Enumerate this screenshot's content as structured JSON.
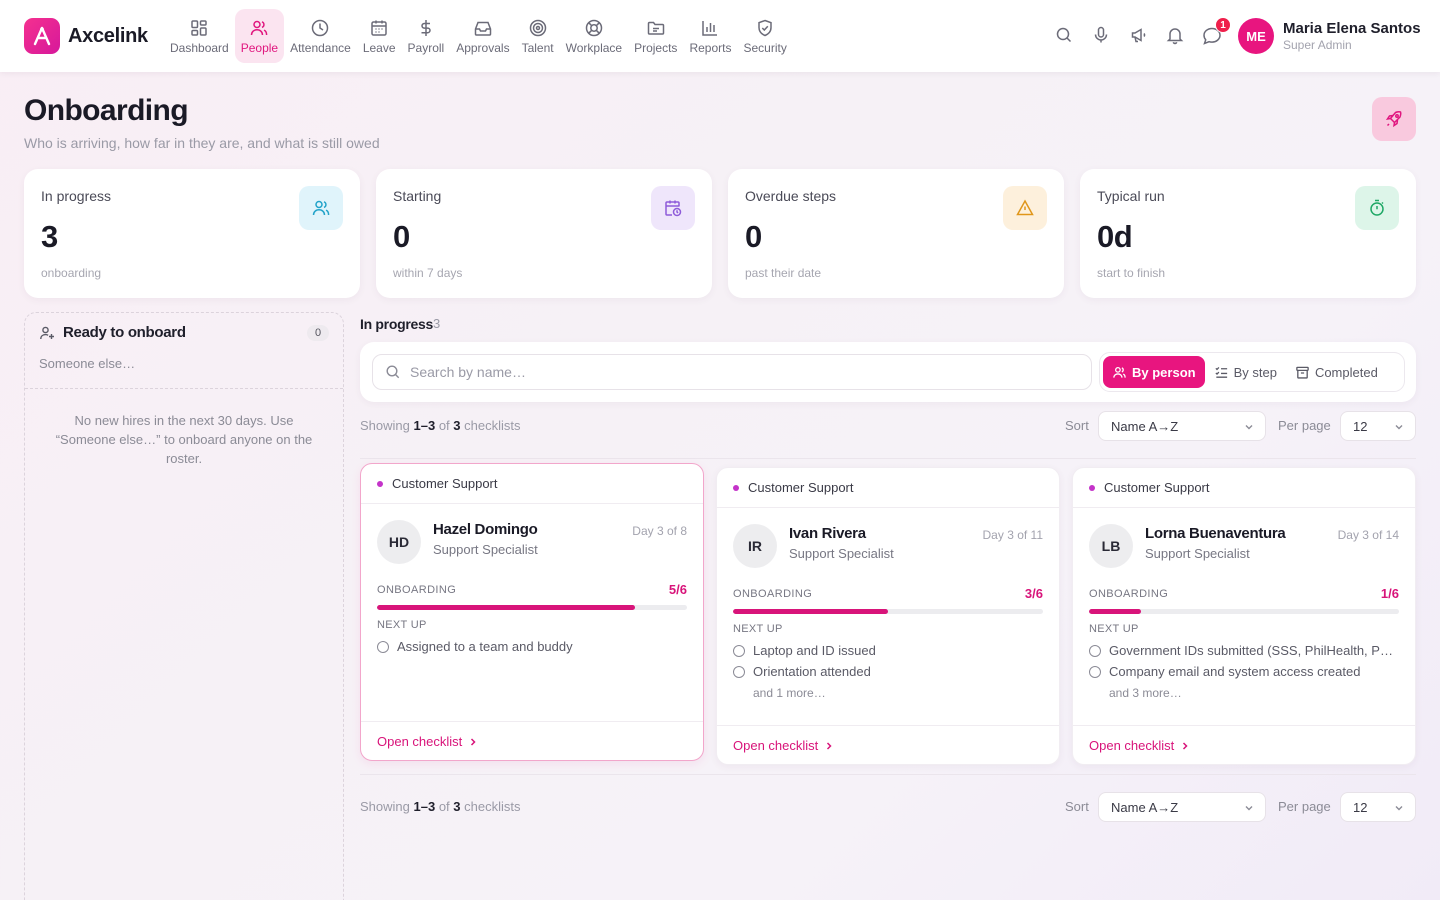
{
  "app": {
    "name": "Axcelink",
    "colors": {
      "accent": "#e8157f",
      "accent_soft": "#fbe4f0",
      "danger": "#ef1f4b"
    }
  },
  "nav": [
    {
      "label": "Dashboard",
      "icon": "dashboard-icon",
      "active": false
    },
    {
      "label": "People",
      "icon": "people-icon",
      "active": true
    },
    {
      "label": "Attendance",
      "icon": "clock-icon",
      "active": false
    },
    {
      "label": "Leave",
      "icon": "calendar-icon",
      "active": false
    },
    {
      "label": "Payroll",
      "icon": "dollar-icon",
      "active": false
    },
    {
      "label": "Approvals",
      "icon": "inbox-icon",
      "active": false
    },
    {
      "label": "Talent",
      "icon": "target-icon",
      "active": false
    },
    {
      "label": "Workplace",
      "icon": "lifebuoy-icon",
      "active": false
    },
    {
      "label": "Projects",
      "icon": "folder-icon",
      "active": false
    },
    {
      "label": "Reports",
      "icon": "bar-chart-icon",
      "active": false
    },
    {
      "label": "Security",
      "icon": "shield-icon",
      "active": false
    }
  ],
  "header": {
    "notification_count": "1",
    "user": {
      "initials": "ME",
      "name": "Maria Elena Santos",
      "role": "Super Admin"
    }
  },
  "page": {
    "title": "Onboarding",
    "subtitle": "Who is arriving, how far in they are, and what is still owed"
  },
  "stats": [
    {
      "label": "In progress",
      "value": "3",
      "note": "onboarding",
      "icon": "users-icon",
      "icon_bg": "#e0f4fb",
      "icon_color": "#22a3c9"
    },
    {
      "label": "Starting",
      "value": "0",
      "note": "within 7 days",
      "icon": "calendar-clock-icon",
      "icon_bg": "#efe6fb",
      "icon_color": "#8e5bd9"
    },
    {
      "label": "Overdue steps",
      "value": "0",
      "note": "past their date",
      "icon": "warning-icon",
      "icon_bg": "#fdf0dc",
      "icon_color": "#e0961a"
    },
    {
      "label": "Typical run",
      "value": "0d",
      "note": "start to finish",
      "icon": "timer-icon",
      "icon_bg": "#ddf5e9",
      "icon_color": "#1fa866"
    }
  ],
  "ready": {
    "title": "Ready to onboard",
    "count": "0",
    "someone_else": "Someone else…",
    "empty": "No new hires in the next 30 days. Use “Someone else…” to onboard anyone on the roster."
  },
  "in_progress": {
    "title": "In progress",
    "count": "3",
    "search_placeholder": "Search by name…",
    "views": [
      {
        "label": "By person",
        "icon": "users-icon",
        "active": true
      },
      {
        "label": "By step",
        "icon": "checklist-icon",
        "active": false
      },
      {
        "label": "Completed",
        "icon": "archive-icon",
        "active": false
      }
    ],
    "showing": {
      "prefix": "Showing",
      "range": "1–3",
      "of": "of",
      "total": "3",
      "suffix": "checklists"
    },
    "sort_label": "Sort",
    "sort_value": "Name A→Z",
    "per_page_label": "Per page",
    "per_page_value": "12",
    "open_label": "Open checklist",
    "onboarding_label": "ONBOARDING",
    "next_up_label": "NEXT UP"
  },
  "people": [
    {
      "department": "Customer Support",
      "initials": "HD",
      "name": "Hazel Domingo",
      "role": "Support Specialist",
      "day": "Day 3 of 8",
      "ratio": "5/6",
      "progress": 0.8333,
      "steps": [
        "Assigned to a team and buddy"
      ],
      "more": ""
    },
    {
      "department": "Customer Support",
      "initials": "IR",
      "name": "Ivan Rivera",
      "role": "Support Specialist",
      "day": "Day 3 of 11",
      "ratio": "3/6",
      "progress": 0.5,
      "steps": [
        "Laptop and ID issued",
        "Orientation attended"
      ],
      "more": "and 1 more…"
    },
    {
      "department": "Customer Support",
      "initials": "LB",
      "name": "Lorna Buenaventura",
      "role": "Support Specialist",
      "day": "Day 3 of 14",
      "ratio": "1/6",
      "progress": 0.1667,
      "steps": [
        "Government IDs submitted (SSS, PhilHealth, Pa…",
        "Company email and system access created"
      ],
      "more": "and 3 more…"
    }
  ]
}
